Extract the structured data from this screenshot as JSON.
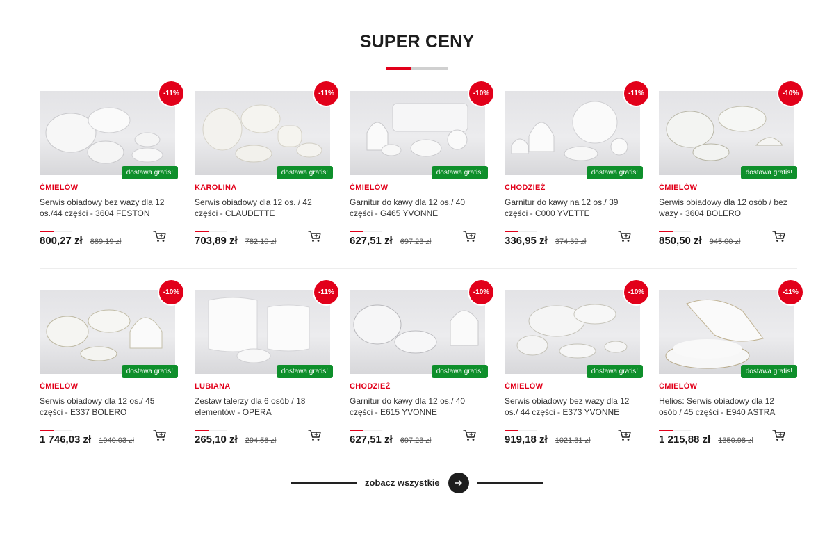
{
  "section": {
    "title": "SUPER CENY"
  },
  "colors": {
    "accent": "#e2001a",
    "free_shipping": "#0e8f2b",
    "dark": "#1e1e1e"
  },
  "products": [
    [
      {
        "discount": "-11%",
        "free_label": "dostawa gratis!",
        "brand": "ĆMIELÓW",
        "name": "Serwis obiadowy bez wazy dla 12 os./44 części - 3604 FESTON",
        "price": "800,27 zł",
        "old_price": "889.19 zł",
        "icon": "cart-icon"
      },
      {
        "discount": "-11%",
        "free_label": "dostawa gratis!",
        "brand": "KAROLINA",
        "name": "Serwis obiadowy dla 12 os. / 42 części - CLAUDETTE",
        "price": "703,89 zł",
        "old_price": "782.10 zł",
        "icon": "cart-icon"
      },
      {
        "discount": "-10%",
        "free_label": "dostawa gratis!",
        "brand": "ĆMIELÓW",
        "name": "Garnitur do kawy dla 12 os./ 40 części - G465 YVONNE",
        "price": "627,51 zł",
        "old_price": "697.23 zł",
        "icon": "cart-icon"
      },
      {
        "discount": "-11%",
        "free_label": "dostawa gratis!",
        "brand": "CHODZIEŻ",
        "name": "Garnitur do kawy na 12 os./ 39 części - C000 YVETTE",
        "price": "336,95 zł",
        "old_price": "374.39 zł",
        "icon": "cart-icon"
      },
      {
        "discount": "-10%",
        "free_label": "dostawa gratis!",
        "brand": "ĆMIELÓW",
        "name": "Serwis obiadowy dla 12 osób / bez wazy - 3604 BOLERO",
        "price": "850,50 zł",
        "old_price": "945.00 zł",
        "icon": "cart-icon"
      }
    ],
    [
      {
        "discount": "-10%",
        "free_label": "dostawa gratis!",
        "brand": "ĆMIELÓW",
        "name": "Serwis obiadowy dla 12 os./ 45 części - E337 BOLERO",
        "price": "1 746,03 zł",
        "old_price": "1940.03 zł",
        "icon": "cart-icon"
      },
      {
        "discount": "-11%",
        "free_label": "dostawa gratis!",
        "brand": "LUBIANA",
        "name": "Zestaw talerzy dla 6 osób / 18 elementów - OPERA",
        "price": "265,10 zł",
        "old_price": "294.56 zł",
        "icon": "cart-icon"
      },
      {
        "discount": "-10%",
        "free_label": "dostawa gratis!",
        "brand": "CHODZIEŻ",
        "name": "Garnitur do kawy dla 12 os./ 40 części - E615 YVONNE",
        "price": "627,51 zł",
        "old_price": "697.23 zł",
        "icon": "cart-icon"
      },
      {
        "discount": "-10%",
        "free_label": "dostawa gratis!",
        "brand": "ĆMIELÓW",
        "name": "Serwis obiadowy bez wazy dla 12 os./ 44 części - E373 YVONNE",
        "price": "919,18 zł",
        "old_price": "1021.31 zł",
        "icon": "cart-icon"
      },
      {
        "discount": "-11%",
        "free_label": "dostawa gratis!",
        "brand": "ĆMIELÓW",
        "name": "Helios: Serwis obiadowy dla 12 osób / 45 części - E940 ASTRA",
        "price": "1 215,88 zł",
        "old_price": "1350.98 zł",
        "icon": "cart-icon"
      }
    ]
  ],
  "see_all": {
    "label": "zobacz wszystkie",
    "icon": "arrow-right-icon"
  }
}
